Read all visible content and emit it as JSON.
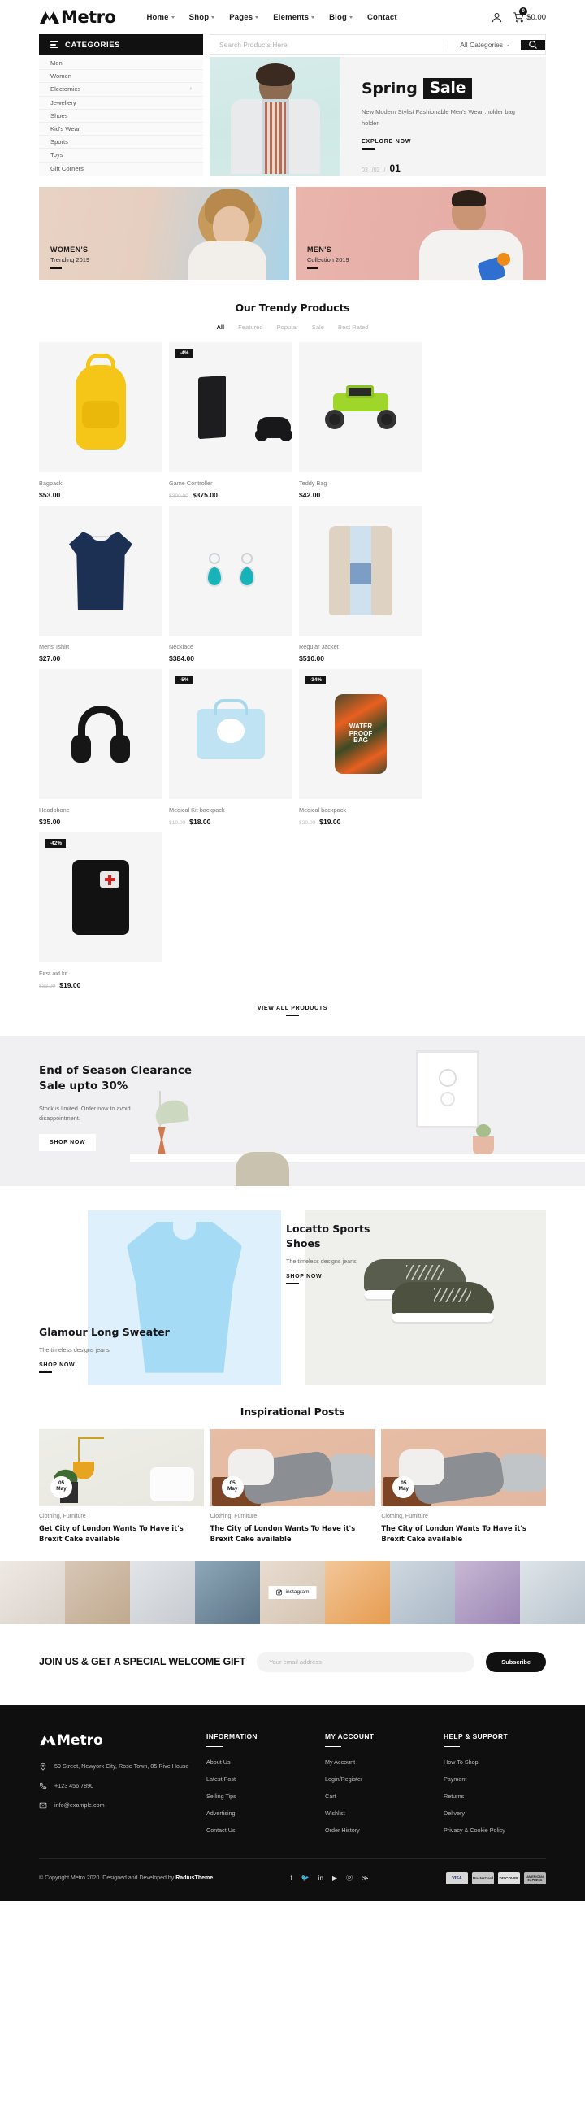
{
  "header": {
    "logo": "Metro",
    "nav": [
      {
        "label": "Home",
        "caret": true
      },
      {
        "label": "Shop",
        "caret": true
      },
      {
        "label": "Pages",
        "caret": true
      },
      {
        "label": "Elements",
        "caret": true
      },
      {
        "label": "Blog",
        "caret": true
      },
      {
        "label": "Contact",
        "caret": false
      }
    ],
    "cart_count": "0",
    "cart_total": "$0.00"
  },
  "search": {
    "categories_button": "CATEGORIES",
    "placeholder": "Search Products Here",
    "category_select": "All Categories"
  },
  "sidebar": {
    "items": [
      {
        "label": "Men",
        "arrow": false
      },
      {
        "label": "Women",
        "arrow": false
      },
      {
        "label": "Electornics",
        "arrow": true
      },
      {
        "label": "Jewellery",
        "arrow": false
      },
      {
        "label": "Shoes",
        "arrow": false
      },
      {
        "label": "Kid's Wear",
        "arrow": false
      },
      {
        "label": "Sports",
        "arrow": false
      },
      {
        "label": "Toys",
        "arrow": false
      },
      {
        "label": "Gift Corners",
        "arrow": false
      }
    ]
  },
  "hero": {
    "title_1": "Spring",
    "title_2": "Sale",
    "subtitle": "New Modern Stylist Fashionable Men's Wear .holder bag holder",
    "cta": "EXPLORE NOW",
    "pager_small_1": "03",
    "pager_small_2": "/02",
    "pager_sep": "/",
    "pager_current": "01"
  },
  "promos": [
    {
      "title": "WOMEN'S",
      "subtitle": "Trending 2019"
    },
    {
      "title": "MEN'S",
      "subtitle": "Collection 2019"
    }
  ],
  "products_section": {
    "title": "Our Trendy Products",
    "tabs": [
      "All",
      "Featured",
      "Popular",
      "Sale",
      "Best Rated"
    ],
    "active_tab": "All",
    "view_all": "VIEW ALL PRODUCTS",
    "items": [
      {
        "name": "Bagpack",
        "price": "$53.00",
        "old_price": "",
        "badge": ""
      },
      {
        "name": "Game Controller",
        "price": "$375.00",
        "old_price": "$390.00",
        "badge": "-4%"
      },
      {
        "name": "Teddy Bag",
        "price": "$42.00",
        "old_price": "",
        "badge": ""
      },
      {
        "name": "Mens Tshirt",
        "price": "$27.00",
        "old_price": "",
        "badge": ""
      },
      {
        "name": "Necklace",
        "price": "$384.00",
        "old_price": "",
        "badge": ""
      },
      {
        "name": "Regular Jacket",
        "price": "$510.00",
        "old_price": "",
        "badge": ""
      },
      {
        "name": "Headphone",
        "price": "$35.00",
        "old_price": "",
        "badge": ""
      },
      {
        "name": "Medical Kit backpack",
        "price": "$18.00",
        "old_price": "$19.00",
        "badge": "-5%"
      },
      {
        "name": "Medical backpack",
        "price": "$19.00",
        "old_price": "$29.00",
        "badge": "-34%"
      },
      {
        "name": "First aid kit",
        "price": "$19.00",
        "old_price": "$33.00",
        "badge": "-42%"
      }
    ]
  },
  "clearance": {
    "title": "End of Season Clearance Sale upto 30%",
    "subtitle": "Stock is limited. Order now to avoid disappointment.",
    "cta": "SHOP NOW"
  },
  "feature_duo": {
    "left": {
      "title": "Glamour Long Sweater",
      "subtitle": "The timeless designs jeans",
      "cta": "SHOP NOW"
    },
    "right": {
      "title": "Locatto Sports Shoes",
      "subtitle": "The timeless designs jeans",
      "cta": "SHOP NOW"
    }
  },
  "blog_section": {
    "title": "Inspirational Posts",
    "posts": [
      {
        "day": "05",
        "month": "May",
        "category": "Clothing, Furniture",
        "title": "Get City of London Wants To Have it's Brexit Cake available"
      },
      {
        "day": "05",
        "month": "May",
        "category": "Clothing, Furniture",
        "title": "The City of London Wants To Have it's Brexit Cake available"
      },
      {
        "day": "05",
        "month": "May",
        "category": "Clothing, Furniture",
        "title": "The City of London Wants To Have it's Brexit Cake available"
      }
    ]
  },
  "instagram": {
    "label": "instagram"
  },
  "newsletter": {
    "title": "JOIN US & GET A SPECIAL WELCOME GIFT",
    "placeholder": "Your email address",
    "button": "Subscribe"
  },
  "footer": {
    "logo": "Metro",
    "address": "59 Street, Newyork City, Rose Town, 05 Rive House",
    "phone": "+123 456 7890",
    "email": "info@example.com",
    "columns": [
      {
        "heading": "INFORMATION",
        "links": [
          "About Us",
          "Latest Post",
          "Selling Tips",
          "Advertising",
          "Contact Us"
        ]
      },
      {
        "heading": "MY ACCOUNT",
        "links": [
          "My Account",
          "Login/Register",
          "Cart",
          "Wishlist",
          "Order History"
        ]
      },
      {
        "heading": "HELP & SUPPORT",
        "links": [
          "How To Shop",
          "Payment",
          "Returns",
          "Delivery",
          "Privacy & Cookie Policy"
        ]
      }
    ],
    "copyright_pre": "© Copyright Metro 2020. Designed and Developed by ",
    "copyright_brand": "RadiusTheme",
    "socials": [
      "facebook-icon",
      "twitter-icon",
      "linkedin-icon",
      "youtube-icon",
      "pinterest-icon",
      "rss-icon"
    ],
    "cards": [
      "VISA",
      "MasterCard",
      "DISCOVER",
      "AMERICAN EXPRESS"
    ]
  }
}
